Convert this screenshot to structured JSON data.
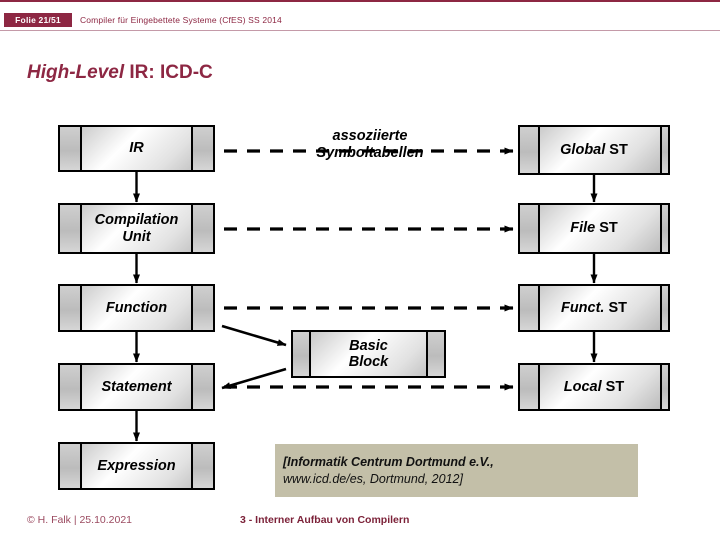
{
  "header": {
    "slide_badge": "Folie 21/51",
    "course": "Compiler für Eingebettete Systeme (CfES) SS 2014",
    "accent_color": "#8d2743"
  },
  "title": {
    "italic_part": "High-Level",
    "upright_part": " IR: ICD-C"
  },
  "diagram": {
    "ir_nodes": [
      {
        "id": "ir",
        "label": "IR"
      },
      {
        "id": "compilation-unit",
        "label": "Compilation\nUnit"
      },
      {
        "id": "function",
        "label": "Function"
      },
      {
        "id": "statement",
        "label": "Statement"
      },
      {
        "id": "expression",
        "label": "Expression"
      }
    ],
    "basic_block": {
      "id": "basic-block",
      "label": "Basic\nBlock"
    },
    "symbol_table_nodes": [
      {
        "id": "global-st",
        "italic": "Global",
        "upright": " ST"
      },
      {
        "id": "file-st",
        "italic": "File",
        "upright": " ST"
      },
      {
        "id": "funct-st",
        "italic": "Funct.",
        "upright": " ST"
      },
      {
        "id": "local-st",
        "italic": "Local",
        "upright": " ST"
      }
    ],
    "association_label": {
      "line1": "assoziierte",
      "line2": "Symboltabellen"
    }
  },
  "caption": {
    "line1": "[Informatik Centrum Dortmund e.V.,",
    "line2": "www.icd.de/es, Dortmund, 2012]",
    "background_color": "#c3bfa8"
  },
  "footer": {
    "copyright": "© H. Falk | 25.10.2021",
    "chapter": "3 - Interner Aufbau von Compilern"
  }
}
